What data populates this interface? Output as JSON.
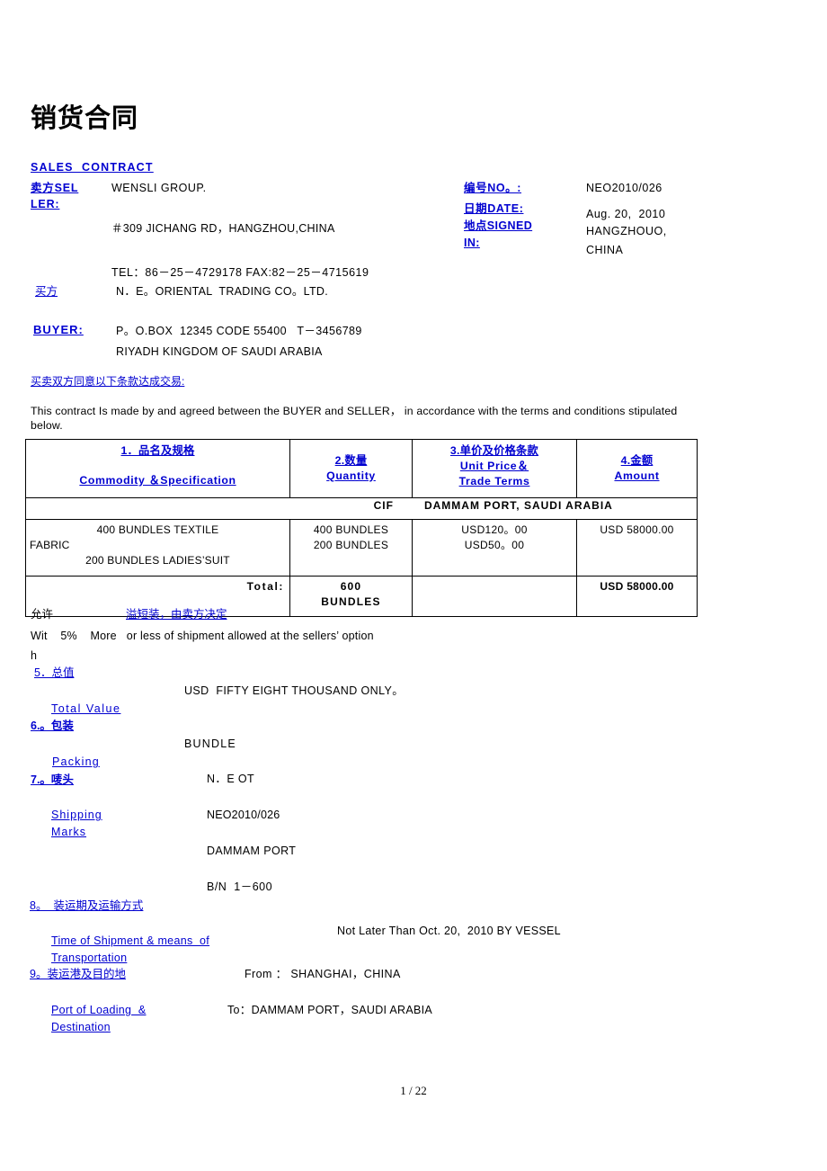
{
  "document": {
    "title_cn": "销货合同",
    "title_en": "SALES  CONTRACT",
    "page_footer": "1 / 22"
  },
  "seller": {
    "label_line1": "卖方SEL",
    "label_line2": "LER:",
    "name": "WENSLI GROUP.",
    "address": "＃309 JICHANG RD，HANGZHOU,CHINA",
    "contact": "TEL：86－25－4729178 FAX:82－25－4715619"
  },
  "buyer": {
    "label_cn": "买方",
    "label_en": "BUYER:",
    "name": "N．E。ORIENTAL  TRADING CO。LTD.",
    "address_line1": "P。O.BOX  12345 CODE 55400   T－3456789",
    "address_line2": "RIYADH KINGDOM OF SAUDI ARABIA"
  },
  "reference": {
    "no_label": "编号NO。:",
    "no_value": "NEO2010/026",
    "date_label": "日期DATE:",
    "date_value": "Aug. 20,  2010",
    "signed_label_line1": "地点SIGNED",
    "signed_label_line2": "IN:",
    "signed_value_line1": "HANGZHOUO,",
    "signed_value_line2": "CHINA"
  },
  "intro": {
    "heading_cn": "买卖双方同意以下条款达成交易:",
    "body": "This  contract Is made by  and agreed  between the BUYER and SELLER， in accordance with  the  terms  and conditions stipulated  below."
  },
  "table": {
    "headers": [
      {
        "cn": "1．品名及规格",
        "en": "Commodity ＆Specification"
      },
      {
        "cn": "2.数量",
        "en": "Quantity"
      },
      {
        "cn": "3.单价及价格条款",
        "en": "Unit Price＆",
        "en2": "Trade Terms"
      },
      {
        "cn": "4.金额",
        "en": "Amount"
      }
    ],
    "terms_row": {
      "incoterm": "CIF",
      "destination": "DAMMAM PORT,  SAUDI ARABIA"
    },
    "rows": [
      {
        "commodity_line1": "400 BUNDLES TEXTILE",
        "commodity_line2": "FABRIC",
        "commodity_line3": "200  BUNDLES LADIES’SUIT",
        "quantity_line1": "400 BUNDLES",
        "quantity_line2": "200   BUNDLES",
        "unit_price_line1": "USD120。00",
        "unit_price_line2": "USD50。00",
        "amount": "USD 58000.00"
      }
    ],
    "total": {
      "label": "Total:",
      "quantity_line1": "600",
      "quantity_line2": "BUNDLES",
      "unit_price": "",
      "amount": "USD 58000.00"
    }
  },
  "clauses": [
    {
      "id": "tolerance",
      "label_cn": "允许",
      "label_cn_link": "溢短装，由卖方决定",
      "body_line1": "Wit    5%    More   or less of shipment allowed at the sellers’ option",
      "body_line2": "h"
    },
    {
      "id": "total-value",
      "number_cn": "5．总值",
      "label_en": "Total Value",
      "value": "USD  FIFTY EIGHT THOUSAND ONLY。"
    },
    {
      "id": "packing",
      "number_cn": "6.。包装",
      "label_en": "Packing",
      "value": "BUNDLE"
    },
    {
      "id": "shipping-marks",
      "number_cn": "7.。唛头",
      "label_en_line1": "Shipping",
      "label_en_line2": "Marks",
      "value_line1": "N．E OT",
      "value_line2": "NEO2010/026",
      "value_line3": "DAMMAM PORT",
      "value_line4": "B/N  1－600"
    },
    {
      "id": "shipment-time",
      "number_cn": "8。  装运期及运输方式",
      "label_en_line1": "Time of Shipment & means  of",
      "label_en_line2": "Transportation",
      "value": "Not Later Than Oct. 20,  2010 BY VESSEL"
    },
    {
      "id": "ports",
      "number_cn": "9。装运港及目的地",
      "label_en_line1": "Port of Loading  &",
      "label_en_line2": "Destination",
      "value_line1": "From ： SHANGHAI，CHINA",
      "value_line2": "To：DAMMAM PORT，SAUDI ARABIA"
    }
  ],
  "colors": {
    "link_blue": "#0000d0",
    "text_black": "#000000",
    "background": "#ffffff"
  }
}
